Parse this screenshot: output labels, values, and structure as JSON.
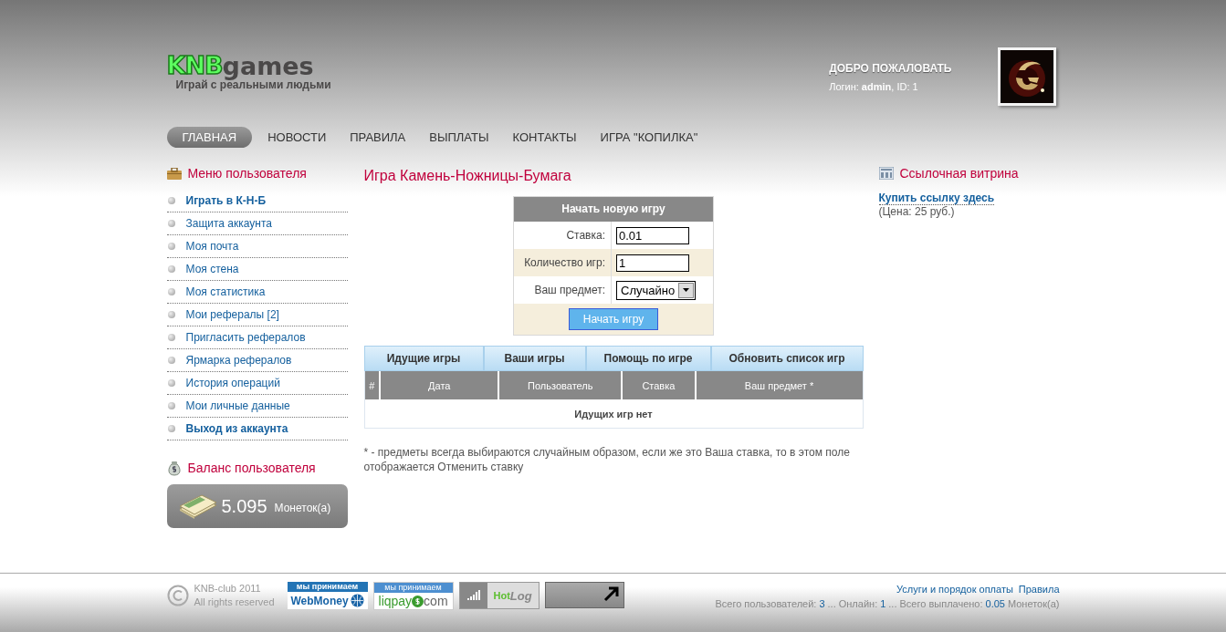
{
  "header": {
    "logo": {
      "mark": "KNB",
      "word": "games"
    },
    "tagline": "Играй с реальными людьми",
    "welcome": "ДОБРО ПОЖАЛОВАТЬ",
    "login_line": "Логин: **admin**, ID: 1"
  },
  "nav": [
    {
      "label": "ГЛАВНАЯ",
      "selected": true
    },
    {
      "label": "НОВОСТИ",
      "selected": false
    },
    {
      "label": "ПРАВИЛА",
      "selected": false
    },
    {
      "label": "ВЫПЛАТЫ",
      "selected": false
    },
    {
      "label": "КОНТАКТЫ",
      "selected": false
    },
    {
      "label": "ИГРА \"КОПИЛКА\"",
      "selected": false
    }
  ],
  "user_menu": {
    "title": "Меню пользователя",
    "items": [
      {
        "label": "Играть в К-Н-Б",
        "bold": true
      },
      {
        "label": "Защита аккаунта",
        "bold": false
      },
      {
        "label": "Моя почта",
        "bold": false
      },
      {
        "label": "Моя стена",
        "bold": false
      },
      {
        "label": "Моя статистика",
        "bold": false
      },
      {
        "label": "Мои рефералы [2]",
        "bold": false
      },
      {
        "label": "Пригласить рефералов",
        "bold": false
      },
      {
        "label": "Ярмарка рефералов",
        "bold": false
      },
      {
        "label": "История операций",
        "bold": false
      },
      {
        "label": "Мои личные данные",
        "bold": false
      },
      {
        "label": "Выход из аккаунта",
        "bold": true
      }
    ]
  },
  "balance": {
    "title": "Баланс пользователя",
    "amount": "5.095",
    "unit": "Монеток(а)"
  },
  "game": {
    "title": "Игра Камень-Ножницы-Бумага",
    "form": {
      "title": "Начать новую игру",
      "fields": [
        {
          "kind": "input",
          "label": "Ставка:",
          "value": "0.01"
        },
        {
          "kind": "input",
          "label": "Количество игр:",
          "value": "1"
        },
        {
          "kind": "select",
          "label": "Ваш предмет:",
          "value": "Случайно"
        }
      ],
      "submit": "Начать игру"
    },
    "tabs": [
      "Идущие игры",
      "Ваши игры",
      "Помощь по игре",
      "Обновить список игр"
    ],
    "table": {
      "columns": [
        "#",
        "Дата",
        "Пользователь",
        "Ставка",
        "Ваш предмет *"
      ],
      "empty_message": "Идущих игр нет"
    },
    "note": "* - предметы всегда выбираются случайным образом, если же это Ваша ставка, то в этом поле отображается Отменить ставку"
  },
  "link_showcase": {
    "title": "Ссылочная витрина",
    "link": "Купить ссылку здесь",
    "price": "(Цена: 25 руб.)"
  },
  "footer": {
    "copyright": [
      "KNB-club 2011",
      "All rights reserved"
    ],
    "badges": [
      {
        "kind": "webmoney",
        "caption": "мы принимаем",
        "brand": "WebMoney"
      },
      {
        "kind": "liqpay",
        "caption": "мы принимаем",
        "brand": "liqpay",
        "suffix": "com"
      },
      {
        "kind": "hotlog",
        "brand": "Hot",
        "suffix": "Log"
      },
      {
        "kind": "counter"
      }
    ],
    "links": [
      "Услуги и порядок оплаты",
      "Правила"
    ],
    "stats": [
      {
        "label": "Всего пользователей:",
        "value": "3"
      },
      {
        "label": "... Онлайн:",
        "value": "1"
      },
      {
        "label": "... Всего выплачено:",
        "value": "0.05"
      }
    ],
    "stats_unit": "Монеток(а)"
  }
}
